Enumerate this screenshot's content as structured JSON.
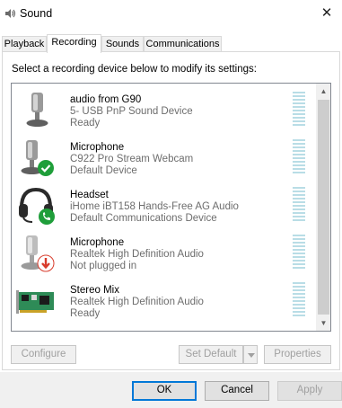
{
  "window": {
    "title": "Sound",
    "close_glyph": "✕"
  },
  "tabs": [
    {
      "label": "Playback",
      "active": false
    },
    {
      "label": "Recording",
      "active": true
    },
    {
      "label": "Sounds",
      "active": false
    },
    {
      "label": "Communications",
      "active": false
    }
  ],
  "instruction": "Select a recording device below to modify its settings:",
  "devices": [
    {
      "name": "audio from G90",
      "description": "5- USB PnP Sound Device",
      "status": "Ready",
      "icon": "microphone-icon",
      "badge": "none"
    },
    {
      "name": "Microphone",
      "description": "C922 Pro Stream Webcam",
      "status": "Default Device",
      "icon": "microphone-icon",
      "badge": "green-check"
    },
    {
      "name": "Headset",
      "description": "iHome iBT158 Hands-Free AG Audio",
      "status": "Default Communications Device",
      "icon": "headset-icon",
      "badge": "green-phone"
    },
    {
      "name": "Microphone",
      "description": "Realtek High Definition Audio",
      "status": "Not plugged in",
      "icon": "microphone-icon",
      "badge": "red-down-arrow"
    },
    {
      "name": "Stereo Mix",
      "description": "Realtek High Definition Audio",
      "status": "Ready",
      "icon": "sound-card-icon",
      "badge": "none"
    }
  ],
  "buttons": {
    "configure": "Configure",
    "set_default": "Set Default",
    "properties": "Properties",
    "ok": "OK",
    "cancel": "Cancel",
    "apply": "Apply"
  },
  "colors": {
    "accent": "#0078d7",
    "meter": "#b9dde6",
    "badge_green": "#1f9e3a",
    "badge_red": "#d83b2b"
  }
}
